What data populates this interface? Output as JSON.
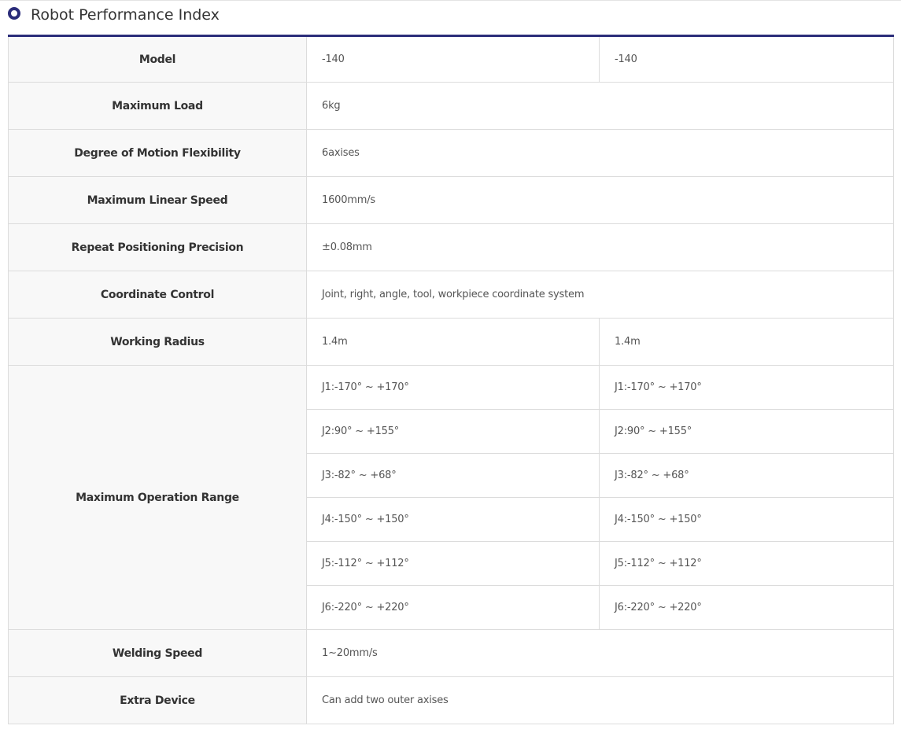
{
  "title": "Robot Performance Index",
  "colors": {
    "accent": "#2b2d7a",
    "header_bg": "#f8f8f8",
    "border": "#dcdcdc"
  },
  "icons": {
    "title": "ring-bullet-icon"
  },
  "rows": {
    "model": {
      "label": "Model",
      "a": "-140",
      "b": "-140"
    },
    "max_load": {
      "label": "Maximum Load",
      "value": "6kg"
    },
    "flexibility": {
      "label": "Degree of Motion Flexibility",
      "value": "6axises"
    },
    "linear_speed": {
      "label": "Maximum Linear Speed",
      "value": "1600mm/s"
    },
    "precision": {
      "label": "Repeat Positioning Precision",
      "value": "±0.08mm"
    },
    "coordinate": {
      "label": "Coordinate Control",
      "value": "Joint, right, angle, tool, workpiece coordinate system"
    },
    "radius": {
      "label": "Working Radius",
      "a": "1.4m",
      "b": "1.4m"
    },
    "operation_range": {
      "label": "Maximum Operation Range",
      "joints": [
        {
          "a": "J1:-170° ~ +170°",
          "b": "J1:-170° ~ +170°"
        },
        {
          "a": "J2:90° ~ +155°",
          "b": "J2:90° ~ +155°"
        },
        {
          "a": "J3:-82° ~ +68°",
          "b": "J3:-82° ~ +68°"
        },
        {
          "a": "J4:-150° ~ +150°",
          "b": "J4:-150° ~ +150°"
        },
        {
          "a": "J5:-112° ~ +112°",
          "b": "J5:-112° ~ +112°"
        },
        {
          "a": "J6:-220° ~ +220°",
          "b": "J6:-220° ~ +220°"
        }
      ]
    },
    "welding_speed": {
      "label": "Welding Speed",
      "value": "1~20mm/s"
    },
    "extra_device": {
      "label": "Extra Device",
      "value": "Can add two outer axises"
    }
  }
}
